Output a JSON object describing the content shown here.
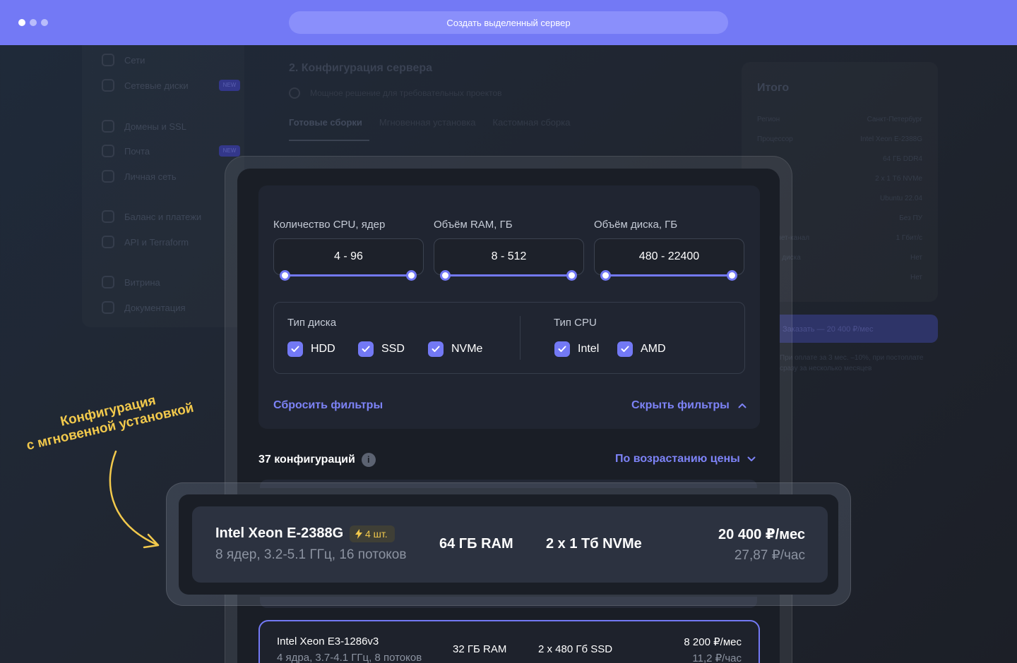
{
  "browser": {
    "url_title": "Создать выделенный сервер"
  },
  "background": {
    "sidebar": [
      {
        "label": "Сети",
        "new": false
      },
      {
        "label": "Сетевые диски",
        "new": true
      },
      {
        "label": "Домены и SSL",
        "new": false
      },
      {
        "label": "Почта",
        "new": true
      },
      {
        "label": "Личная сеть",
        "new": false
      },
      {
        "label": "Баланс и платежи",
        "new": false
      },
      {
        "label": "API и Terraform",
        "new": false
      },
      {
        "label": "Витрина",
        "new": false
      },
      {
        "label": "Документация",
        "new": false
      }
    ],
    "new_badge": "NEW",
    "section_title": "2. Конфигурация сервера",
    "section_sub": "Мощное решение для требовательных проектов",
    "tabs": [
      "Готовые сборки",
      "Мгновенная установка",
      "Кастомная сборка"
    ],
    "summary_title": "Итого",
    "summary_rows": [
      {
        "k": "Регион",
        "v": "Санкт-Петербург"
      },
      {
        "k": "Процессор",
        "v": "Intel Xeon E-2388G"
      },
      {
        "k": "",
        "v": "64 ГБ DDR4"
      },
      {
        "k": "",
        "v": "2 x 1 Тб NVMe"
      },
      {
        "k": "",
        "v": "Ubuntu 22.04"
      },
      {
        "k": "",
        "v": "Без ПУ"
      },
      {
        "k": "Интернет-канал",
        "v": "1 Гбит/с"
      },
      {
        "k": "Резерв диска",
        "v": "Нет"
      },
      {
        "k": "IP",
        "v": "Нет"
      }
    ],
    "order_button": "Заказать — 20 400 ₽/мес",
    "order_note": "При оплате за 3 мес. –10%, при постоплате сразу за несколько месяцев"
  },
  "filters": {
    "cpu_label": "Количество CPU, ядер",
    "cpu_range": "4 - 96",
    "ram_label": "Объём RAM, ГБ",
    "ram_range": "8 - 512",
    "disk_label": "Объём диска, ГБ",
    "disk_range": "480 - 22400",
    "disk_type_label": "Тип диска",
    "disk_types": [
      "HDD",
      "SSD",
      "NVMe"
    ],
    "cpu_type_label": "Тип CPU",
    "cpu_types": [
      "Intel",
      "AMD"
    ],
    "reset": "Сбросить фильтры",
    "hide": "Скрыть фильтры"
  },
  "results": {
    "count": "37 конфигураций",
    "sort": "По возрастанию цены"
  },
  "cards": [
    {
      "name": "Intel Xeon E-2388G",
      "badge": "4 шт.",
      "sub": "8 ядер, 3.2-5.1 ГГц, 16 потоков",
      "ram": "64 ГБ RAM",
      "disk": "2 x 1 Тб NVMe",
      "price": "20 400 ₽/мес",
      "price_hour": "27,87 ₽/час"
    },
    {
      "name": "Intel Xeon E3-1286v3",
      "sub": "4 ядра, 3.7-4.1 ГГц, 8 потоков",
      "ram": "32 ГБ RAM",
      "disk": "2 x 480 Гб SSD",
      "price": "8 200 ₽/мес",
      "price_hour": "11,2 ₽/час"
    }
  ],
  "annotation": {
    "line1": "Конфигурация",
    "line2": "с мгновенной установкой"
  },
  "colors": {
    "accent": "#7379f5",
    "highlight": "#f2c94c"
  }
}
